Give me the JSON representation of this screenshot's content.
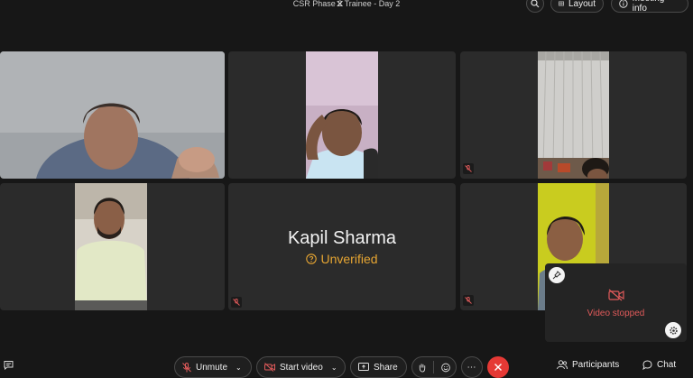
{
  "meeting": {
    "title": "CSR Phase 2 Trainee - Day 2"
  },
  "top_controls": {
    "layout_label": "Layout",
    "meeting_info_label": "Meeting info"
  },
  "participants": [
    {
      "tile": "video-1",
      "muted": false
    },
    {
      "tile": "video-2",
      "muted": false
    },
    {
      "tile": "video-3",
      "muted": true
    },
    {
      "tile": "video-4",
      "muted": false
    },
    {
      "tile": "kapil",
      "name": "Kapil Sharma",
      "status": "Unverified",
      "muted": true
    },
    {
      "tile": "video-6",
      "muted": true
    }
  ],
  "self_view": {
    "status_label": "Video stopped"
  },
  "toolbar": {
    "unmute_label": "Unmute",
    "start_video_label": "Start video",
    "share_label": "Share",
    "participants_label": "Participants",
    "chat_label": "Chat"
  },
  "colors": {
    "background": "#171717",
    "tile": "#2b2b2b",
    "end_call": "#e53935",
    "warning": "#e6a532",
    "video_stopped": "#e05a5a"
  }
}
